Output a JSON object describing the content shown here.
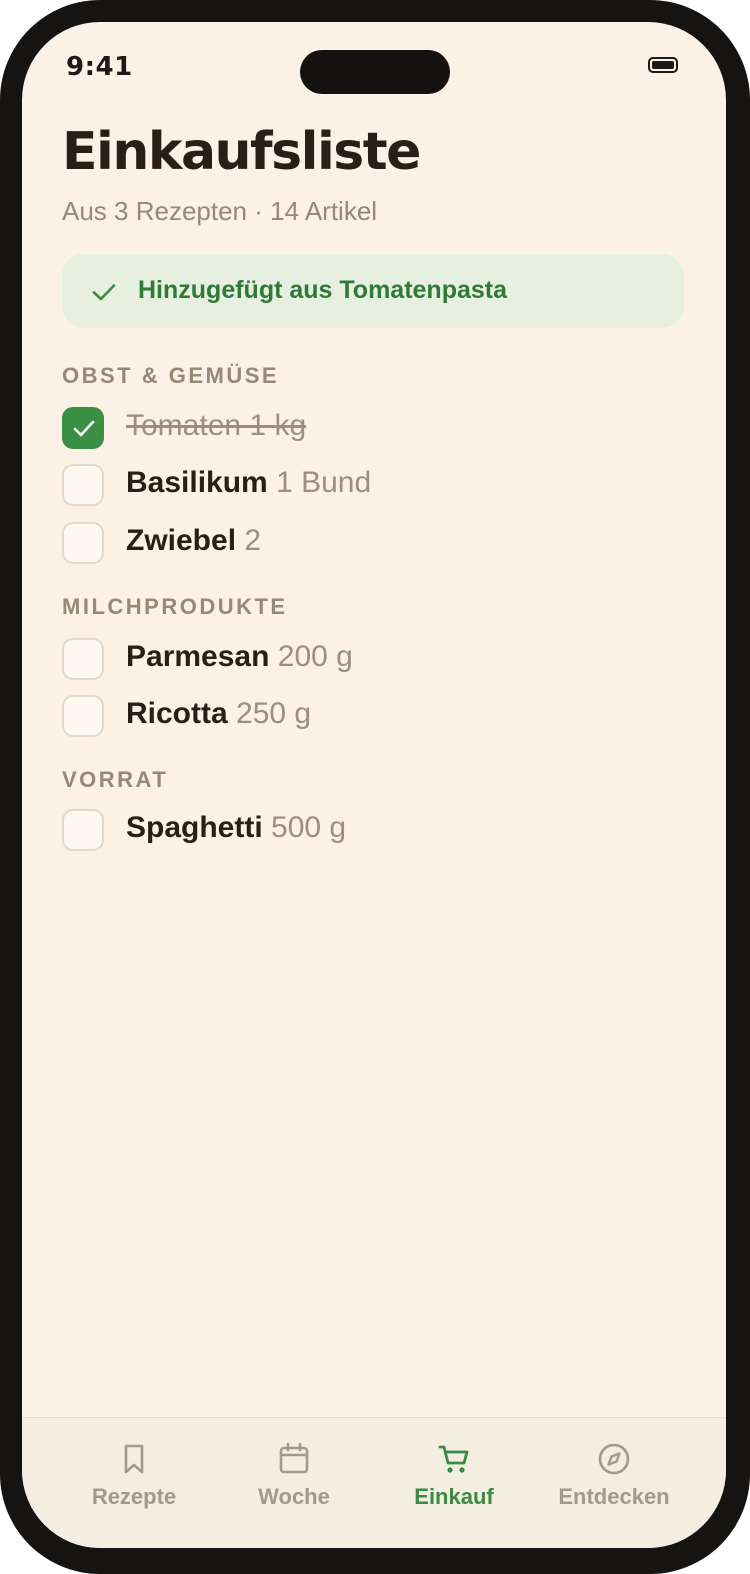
{
  "status_bar": {
    "time": "9:41"
  },
  "header": {
    "title": "Einkaufsliste",
    "subtitle": "Aus 3 Rezepten · 14 Artikel"
  },
  "banner": {
    "icon": "check-icon",
    "text": "Hinzugefügt aus Tomatenpasta"
  },
  "sections": [
    {
      "title": "OBST & GEMÜSE",
      "items": [
        {
          "name": "Tomaten",
          "qty": "1 kg",
          "checked": true
        },
        {
          "name": "Basilikum",
          "qty": "1 Bund",
          "checked": false
        },
        {
          "name": "Zwiebel",
          "qty": "2",
          "checked": false
        }
      ]
    },
    {
      "title": "MILCHPRODUKTE",
      "items": [
        {
          "name": "Parmesan",
          "qty": "200 g",
          "checked": false
        },
        {
          "name": "Ricotta",
          "qty": "250 g",
          "checked": false
        }
      ]
    },
    {
      "title": "VORRAT",
      "items": [
        {
          "name": "Spaghetti",
          "qty": "500 g",
          "checked": false
        }
      ]
    }
  ],
  "tabbar": {
    "tabs": [
      {
        "label": "Rezepte",
        "icon": "bookmark-icon",
        "active": false
      },
      {
        "label": "Woche",
        "icon": "calendar-icon",
        "active": false
      },
      {
        "label": "Einkauf",
        "icon": "cart-icon",
        "active": true
      },
      {
        "label": "Entdecken",
        "icon": "compass-icon",
        "active": false
      }
    ]
  },
  "colors": {
    "background": "#fbf1e6",
    "accent_green": "#3b8f45",
    "banner_bg": "#e6efe0",
    "muted_text": "#978878"
  }
}
